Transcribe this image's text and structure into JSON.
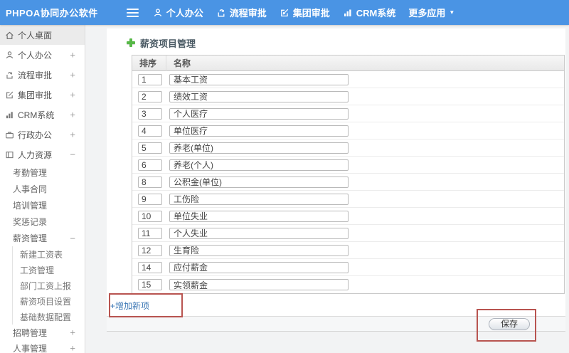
{
  "header": {
    "logo": "PHPOA协同办公软件",
    "nav_items": [
      {
        "label": "个人办公"
      },
      {
        "label": "流程审批"
      },
      {
        "label": "集团审批"
      },
      {
        "label": "CRM系统"
      },
      {
        "label": "更多应用"
      }
    ],
    "more_caret": "▼"
  },
  "sidebar": {
    "top_items": [
      {
        "label": "个人桌面",
        "toggle": ""
      },
      {
        "label": "个人办公",
        "toggle": "+"
      },
      {
        "label": "流程审批",
        "toggle": "+"
      },
      {
        "label": "集团审批",
        "toggle": "+"
      },
      {
        "label": "CRM系统",
        "toggle": "+"
      },
      {
        "label": "行政办公",
        "toggle": "+"
      },
      {
        "label": "人力资源",
        "toggle": "−"
      }
    ],
    "sub_items": [
      {
        "label": "考勤管理",
        "toggle": ""
      },
      {
        "label": "人事合同",
        "toggle": ""
      },
      {
        "label": "培训管理",
        "toggle": ""
      },
      {
        "label": "奖惩记录",
        "toggle": ""
      },
      {
        "label": "薪资管理",
        "toggle": "−"
      }
    ],
    "subsub_items": [
      {
        "label": "新建工资表"
      },
      {
        "label": "工资管理"
      },
      {
        "label": "部门工资上报"
      },
      {
        "label": "薪资项目设置"
      },
      {
        "label": "基础数据配置"
      }
    ],
    "bottom_items": [
      {
        "label": "招聘管理",
        "toggle": "+"
      },
      {
        "label": "人事管理",
        "toggle": "+"
      }
    ]
  },
  "main": {
    "page_title": "薪资项目管理",
    "table": {
      "col_order": "排序",
      "col_name": "名称",
      "rows": [
        {
          "order": "1",
          "name": "基本工资"
        },
        {
          "order": "2",
          "name": "绩效工资"
        },
        {
          "order": "3",
          "name": "个人医疗"
        },
        {
          "order": "4",
          "name": "单位医疗"
        },
        {
          "order": "5",
          "name": "养老(单位)"
        },
        {
          "order": "6",
          "name": "养老(个人)"
        },
        {
          "order": "8",
          "name": "公积金(单位)"
        },
        {
          "order": "9",
          "name": "工伤险"
        },
        {
          "order": "10",
          "name": "单位失业"
        },
        {
          "order": "11",
          "name": "个人失业"
        },
        {
          "order": "12",
          "name": "生育险"
        },
        {
          "order": "14",
          "name": "应付薪金"
        },
        {
          "order": "15",
          "name": "实领薪金"
        }
      ]
    },
    "add_link": "+增加新项",
    "save_button": "保存"
  },
  "colors": {
    "header_blue": "#4a94e4",
    "accent_green": "#57b847",
    "link_blue": "#3d78b5",
    "annotation_red": "#b85450"
  }
}
